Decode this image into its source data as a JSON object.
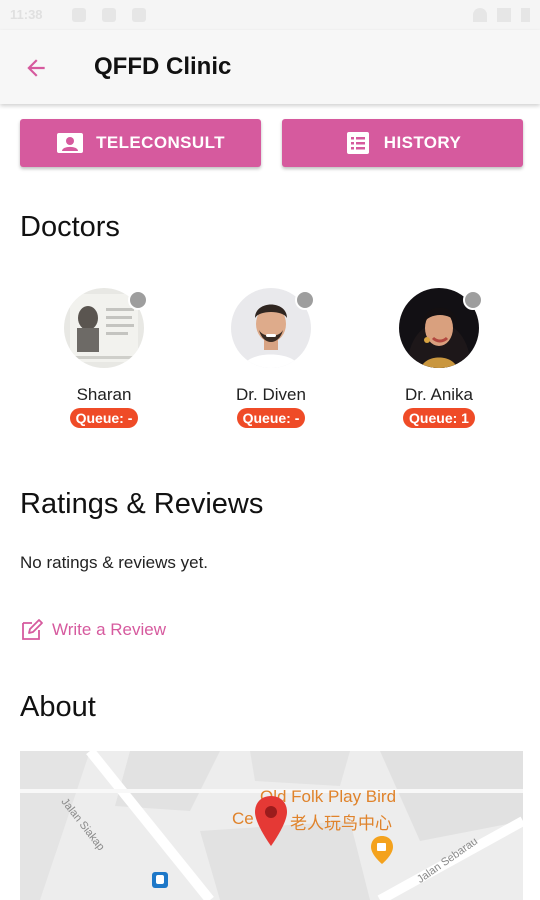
{
  "status_bar": {
    "time": "11:38"
  },
  "app_bar": {
    "title": "QFFD Clinic",
    "back_icon": "arrow-back-icon"
  },
  "colors": {
    "accent": "#d65a9e",
    "queue_badge": "#ef4b27",
    "status_offline": "#9e9e9e"
  },
  "actions": {
    "teleconsult_label": "TELECONSULT",
    "teleconsult_icon": "account-box-icon",
    "history_label": "HISTORY",
    "history_icon": "list-icon"
  },
  "doctors_section": {
    "heading": "Doctors",
    "doctors": [
      {
        "name": "Sharan",
        "queue": "Queue: -"
      },
      {
        "name": "Dr. Diven",
        "queue": "Queue: -"
      },
      {
        "name": "Dr. Anika",
        "queue": "Queue: 1"
      }
    ]
  },
  "reviews_section": {
    "heading": "Ratings & Reviews",
    "empty_text": "No ratings & reviews yet.",
    "write_review_label": "Write a Review",
    "write_review_icon": "edit-icon"
  },
  "about_section": {
    "heading": "About",
    "map": {
      "place_label_line1": "Old Folk Play Bird",
      "place_label_line2": "Ce",
      "place_label_cn": "老人玩鸟中心",
      "road_1": "Jalan Siakap",
      "road_2": "Jalan Sebarau"
    }
  }
}
